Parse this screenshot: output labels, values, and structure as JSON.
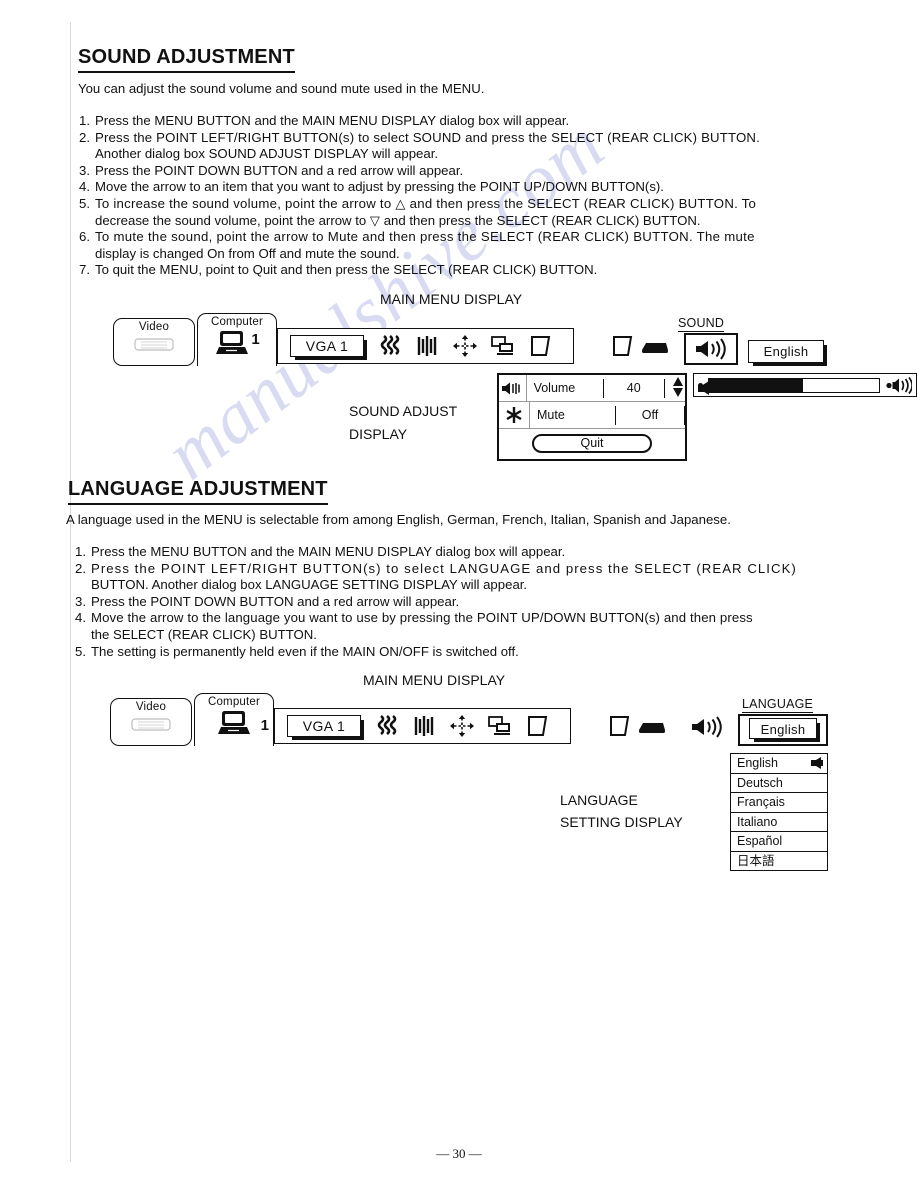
{
  "page": {
    "number_label": "— 30 —"
  },
  "sound_section": {
    "title": "SOUND ADJUSTMENT",
    "intro": "You can adjust the sound volume and sound mute used in the MENU.",
    "steps": [
      {
        "num": "1.",
        "lines": [
          "Press the MENU BUTTON and the MAIN MENU DISPLAY dialog box will appear."
        ]
      },
      {
        "num": "2.",
        "lines": [
          "Press the POINT LEFT/RIGHT BUTTON(s) to select SOUND and press the SELECT (REAR CLICK) BUTTON.",
          "Another dialog box SOUND ADJUST DISPLAY will appear."
        ]
      },
      {
        "num": "3.",
        "lines": [
          "Press the POINT DOWN BUTTON and a red arrow will appear."
        ]
      },
      {
        "num": "4.",
        "lines": [
          "Move the arrow to an item that you want to adjust by pressing the POINT UP/DOWN BUTTON(s)."
        ]
      },
      {
        "num": "5.",
        "lines": [
          "To increase the sound volume, point the arrow to △ and then press the SELECT (REAR CLICK) BUTTON. To",
          "decrease the sound volume, point the arrow to ▽ and then press the SELECT (REAR CLICK) BUTTON."
        ]
      },
      {
        "num": "6.",
        "lines": [
          "To mute the sound, point the arrow to Mute and then press the SELECT (REAR CLICK) BUTTON. The mute",
          "display is changed On from Off and mute the sound."
        ]
      },
      {
        "num": "7.",
        "lines": [
          "To quit the MENU, point to Quit and then press the SELECT (REAR CLICK) BUTTON."
        ]
      }
    ]
  },
  "language_section": {
    "title": "LANGUAGE ADJUSTMENT",
    "intro": "A language used in the MENU is selectable from among English, German, French, Italian, Spanish and Japanese.",
    "steps": [
      {
        "num": "1.",
        "lines": [
          "Press the MENU BUTTON and the MAIN MENU DISPLAY dialog box will appear."
        ]
      },
      {
        "num": "2.",
        "lines": [
          "Press the POINT LEFT/RIGHT BUTTON(s) to select LANGUAGE and press the SELECT (REAR CLICK)",
          "BUTTON. Another dialog box LANGUAGE SETTING DISPLAY will appear."
        ]
      },
      {
        "num": "3.",
        "lines": [
          "Press the POINT DOWN BUTTON and a red arrow will appear."
        ]
      },
      {
        "num": "4.",
        "lines": [
          "Move the arrow to the language you want to use by pressing the POINT UP/DOWN BUTTON(s) and then press",
          "the SELECT (REAR CLICK) BUTTON."
        ]
      },
      {
        "num": "5.",
        "lines": [
          "The setting is permanently held even if the MAIN ON/OFF is switched off."
        ]
      }
    ]
  },
  "diagram_sound": {
    "caption": "MAIN MENU DISPLAY",
    "tab_video": "Video",
    "tab_computer": "Computer",
    "computer_number": "1",
    "vga_label": "VGA 1",
    "icons": [
      "fine-sync-icon",
      "total-dots-icon",
      "position-icon",
      "screen-image-icon",
      "keystone-icon",
      "blank-screen-icon",
      "no-show-icon"
    ],
    "sound_label": "SOUND",
    "sound_icon": "speaker-icon",
    "english_button": "English",
    "volume_bar_percent": 55,
    "volume_bar_icon": "speaker-small-icon",
    "dialog_caption_line1": "SOUND ADJUST",
    "dialog_caption_line2": "DISPLAY",
    "dialog": {
      "rows": [
        {
          "icon": "speaker-icon",
          "name": "Volume",
          "value": "40",
          "has_spinner": true,
          "has_pointer": true
        },
        {
          "icon": "mute-asterisk-icon",
          "name": "Mute",
          "value": "Off",
          "has_spinner": false,
          "has_pointer": false
        }
      ],
      "quit_label": "Quit"
    }
  },
  "diagram_language": {
    "caption": "MAIN MENU DISPLAY",
    "tab_video": "Video",
    "tab_computer": "Computer",
    "computer_number": "1",
    "vga_label": "VGA 1",
    "language_label": "LANGUAGE",
    "selected_language": "English",
    "dialog_caption_line1": "LANGUAGE",
    "dialog_caption_line2": "SETTING DISPLAY",
    "language_options": [
      {
        "label": "English",
        "selected": true
      },
      {
        "label": "Deutsch",
        "selected": false
      },
      {
        "label": "Français",
        "selected": false
      },
      {
        "label": "Italiano",
        "selected": false
      },
      {
        "label": "Español",
        "selected": false
      },
      {
        "label": "日本語",
        "selected": false
      }
    ]
  },
  "watermark": {
    "text": "manualshive.com"
  }
}
